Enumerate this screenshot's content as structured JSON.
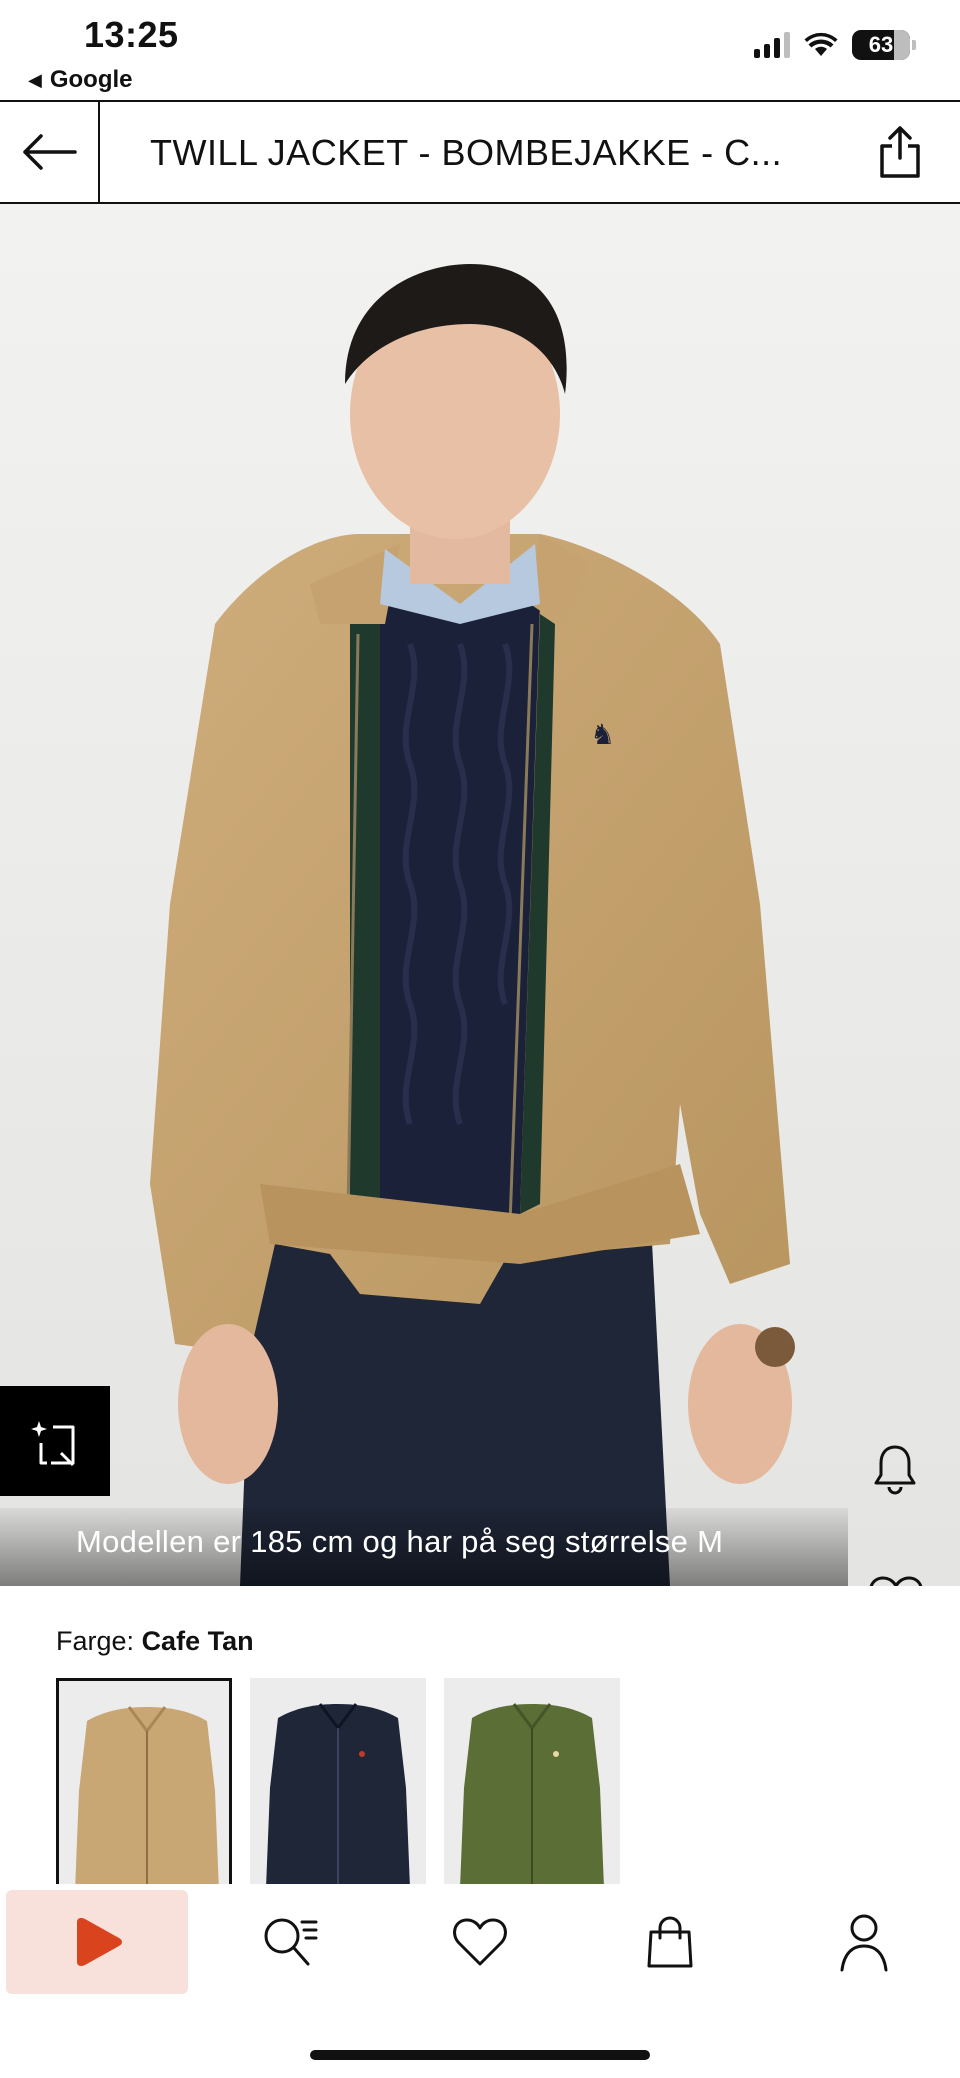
{
  "status_bar": {
    "time": "13:25",
    "back_app": "Google",
    "battery": "63"
  },
  "header": {
    "title": "TWILL JACKET - BOMBEJAKKE - C..."
  },
  "hero": {
    "caption": "Modellen er 185 cm og har på seg størrelse M"
  },
  "color_section": {
    "label": "Farge:",
    "selected": "Cafe Tan",
    "swatches": [
      {
        "name": "Cafe Tan",
        "color": "#c9a775"
      },
      {
        "name": "Navy",
        "color": "#1e2638"
      },
      {
        "name": "Green",
        "color": "#5a6e35"
      }
    ]
  },
  "icons": {
    "back": "arrow-left-icon",
    "share": "share-icon",
    "scan": "visual-search-icon",
    "bell": "bell-icon",
    "heart": "heart-icon",
    "bag": "shopping-bag-icon",
    "nav": [
      "play-icon",
      "search-list-icon",
      "heart-icon",
      "shopping-bag-icon",
      "profile-icon"
    ]
  },
  "colors": {
    "accent": "#d9431e",
    "play_bg": "#f9e1db"
  }
}
